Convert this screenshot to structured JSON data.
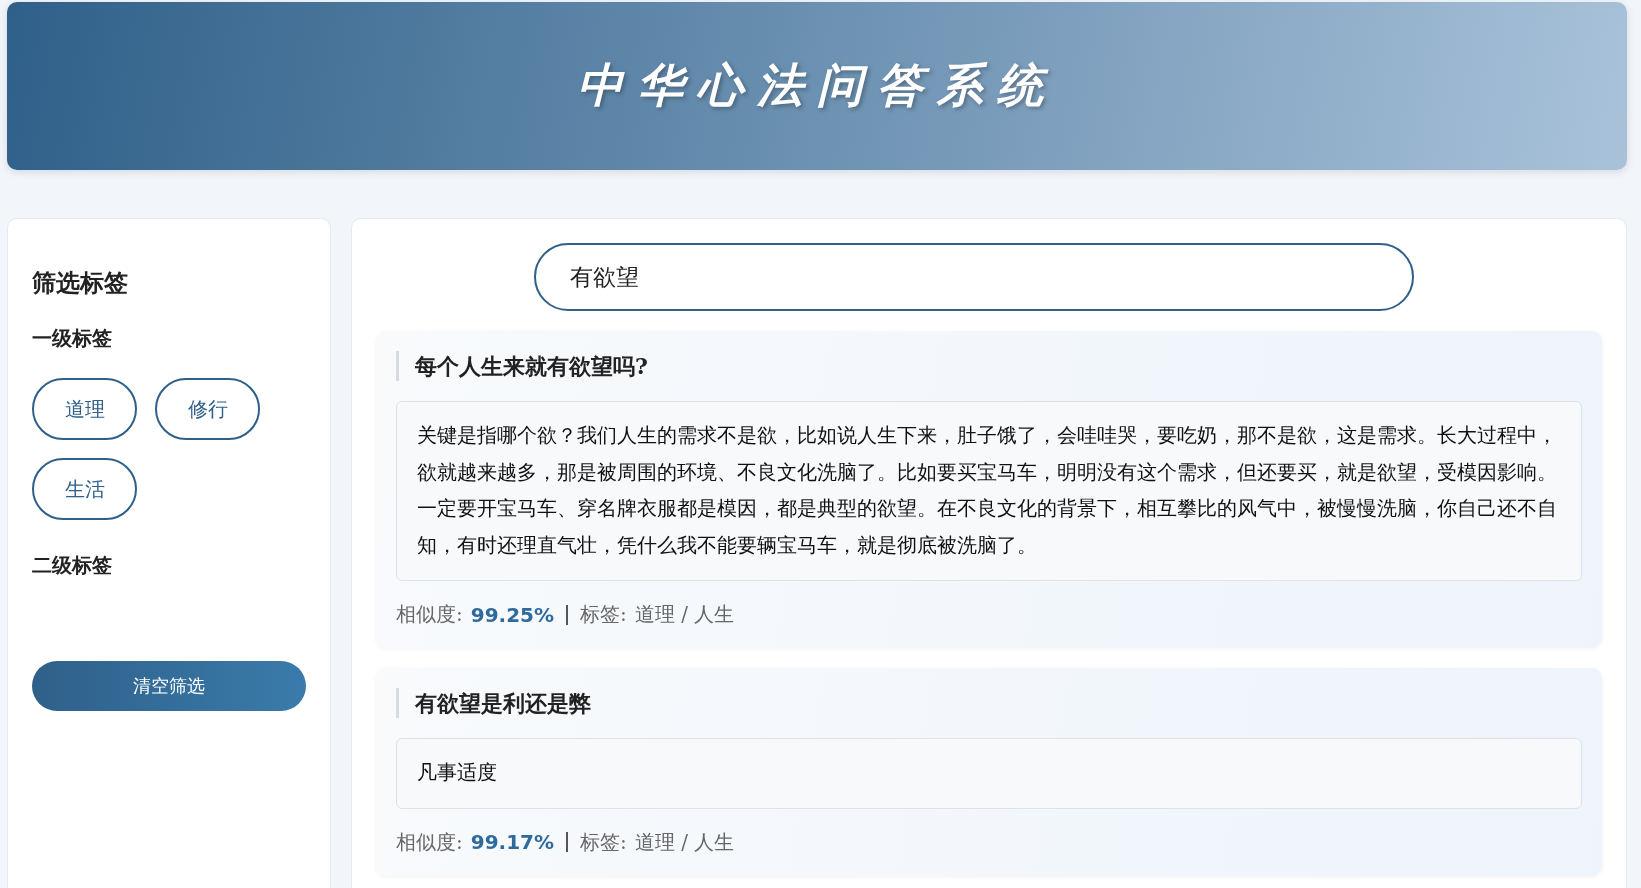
{
  "header": {
    "title": "中华心法问答系统"
  },
  "sidebar": {
    "title": "筛选标签",
    "level1": {
      "heading": "一级标签",
      "tags": [
        {
          "label": "道理",
          "selected": false
        },
        {
          "label": "修行",
          "selected": false
        },
        {
          "label": "生活",
          "selected": false
        }
      ]
    },
    "level2": {
      "heading": "二级标签"
    },
    "clear_button": "清空筛选"
  },
  "search": {
    "value": "有欲望"
  },
  "results": [
    {
      "question": "每个人生来就有欲望吗?",
      "answer": "关键是指哪个欲？我们人生的需求不是欲，比如说人生下来，肚子饿了，会哇哇哭，要吃奶，那不是欲，这是需求。长大过程中，欲就越来越多，那是被周围的环境、不良文化洗脑了。比如要买宝马车，明明没有这个需求，但还要买，就是欲望，受模因影响。一定要开宝马车、穿名牌衣服都是模因，都是典型的欲望。在不良文化的背景下，相互攀比的风气中，被慢慢洗脑，你自己还不自知，有时还理直气壮，凭什么我不能要辆宝马车，就是彻底被洗脑了。",
      "similarity_label": "相似度:",
      "similarity": "99.25%",
      "tags_label": "标签:",
      "tag_path": "道理 / 人生"
    },
    {
      "question": "有欲望是利还是弊",
      "answer": "凡事适度",
      "similarity_label": "相似度:",
      "similarity": "99.17%",
      "tags_label": "标签:",
      "tag_path": "道理 / 人生"
    }
  ]
}
